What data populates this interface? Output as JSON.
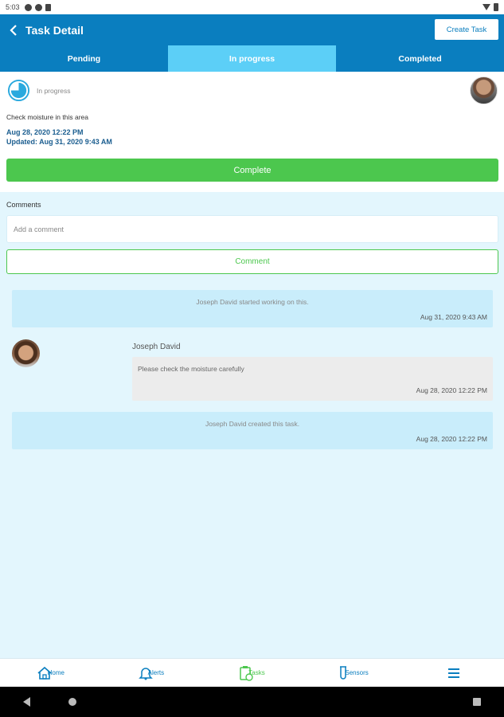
{
  "status_bar": {
    "time": "5:03"
  },
  "header": {
    "title": "Task Detail",
    "create_task_label": "Create Task"
  },
  "tabs": [
    {
      "label": "Pending",
      "active": false
    },
    {
      "label": "In progress",
      "active": true
    },
    {
      "label": "Completed",
      "active": false
    }
  ],
  "task": {
    "status": "In progress",
    "description": "Check moisture in this area",
    "created": "Aug 28, 2020 12:22 PM",
    "updated": "Updated: Aug 31, 2020 9:43 AM",
    "complete_label": "Complete"
  },
  "comments": {
    "label": "Comments",
    "input_placeholder": "Add a comment",
    "button_label": "Comment"
  },
  "activity": [
    {
      "text": "Joseph David started working on this.",
      "date": "Aug 31, 2020 9:43 AM"
    },
    {
      "text": "Joseph David created this task.",
      "date": "Aug 28, 2020 12:22 PM"
    }
  ],
  "comment": {
    "author": "Joseph David",
    "text": "Please check the moisture carefully",
    "date": "Aug 28, 2020 12:22 PM"
  },
  "bottom_nav": [
    {
      "label": "Home",
      "icon": "home-icon"
    },
    {
      "label": "Alerts",
      "icon": "bell-icon"
    },
    {
      "label": "Tasks",
      "icon": "tasks-icon"
    },
    {
      "label": "Sensors",
      "icon": "sensor-icon"
    },
    {
      "label": "",
      "icon": "menu-icon"
    }
  ],
  "colors": {
    "primary": "#0a7ebf",
    "active_tab": "#5ccff7",
    "success": "#4cc74e",
    "background": "#e3f6fd"
  }
}
